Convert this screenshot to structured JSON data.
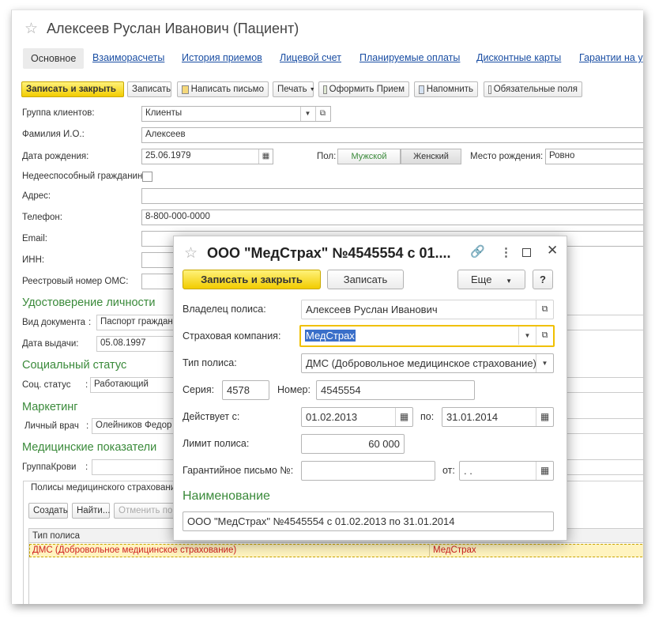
{
  "window": {
    "title": "Алексеев Руслан Иванович (Пациент)"
  },
  "tabs": [
    "Основное",
    "Взаиморасчеты",
    "История приемов",
    "Лицевой счет",
    "Планируемые оплаты",
    "Дисконтные карты",
    "Гарантии на у"
  ],
  "toolbar": {
    "save_close": "Записать и закрыть",
    "save": "Записать",
    "write_letter": "Написать письмо",
    "print": "Печать",
    "make_appointment": "Оформить Прием",
    "remind": "Напомнить",
    "required_fields": "Обязательные поля"
  },
  "form": {
    "client_group_label": "Группа клиентов:",
    "client_group_value": "Клиенты",
    "fio_label": "Фамилия И.О.:",
    "fio_value": "Алексеев",
    "birth_label": "Дата рождения:",
    "birth_value": "25.06.1979",
    "gender_label": "Пол:",
    "gender_male": "Мужской",
    "gender_female": "Женский",
    "birthplace_label": "Место рождения:",
    "birthplace_value": "Ровно",
    "incapable_label": "Недееспособный гражданин:",
    "address_label": "Адрес:",
    "phone_label": "Телефон:",
    "phone_value": "8-800-000-0000",
    "email_label": "Email:",
    "inn_label": "ИНН:",
    "oms_label": "Реестровый номер ОМС:"
  },
  "identity": {
    "header": "Удостоверение личности",
    "doc_type_label": "Вид документа",
    "doc_type_value": "Паспорт граждани",
    "issue_date_label": "Дата выдачи:",
    "issue_date_value": "05.08.1997"
  },
  "social": {
    "header": "Социальный статус",
    "status_label": "Соц. статус",
    "status_value": "Работающий"
  },
  "marketing": {
    "header": "Маркетинг",
    "doctor_label": "Личный врач",
    "doctor_value": "Олейников Федор С"
  },
  "medical": {
    "header": "Медицинские показатели",
    "blood_label": "ГруппаКрови"
  },
  "policies": {
    "group_title": "Полисы медицинского страховани",
    "create": "Создать",
    "find": "Найти...",
    "cancel_search": "Отменить пои",
    "col_type": "Тип полиса",
    "row_type": "ДМС (Добровольное медицинское страхование)",
    "row_company": "МедСтрах"
  },
  "dialog": {
    "title": "ООО \"МедСтрах\" №4545554 с 01....",
    "save_close": "Записать и закрыть",
    "save": "Записать",
    "more": "Еще",
    "help": "?",
    "owner_label": "Владелец полиса:",
    "owner_value": "Алексеев Руслан Иванович",
    "company_label": "Страховая компания:",
    "company_value": "МедСтрах",
    "type_label": "Тип полиса:",
    "type_value": "ДМС (Добровольное медицинское страхование)",
    "series_label": "Серия:",
    "series_value": "4578",
    "number_label": "Номер:",
    "number_value": "4545554",
    "valid_from_label": "Действует с:",
    "valid_from_value": "01.02.2013",
    "valid_to_label": "по:",
    "valid_to_value": "31.01.2014",
    "limit_label": "Лимит полиса:",
    "limit_value": "60 000",
    "guarantee_label": "Гарантийное письмо №:",
    "from_label": "от:",
    "from_value": " .  .",
    "name_header": "Наименование",
    "name_value": "ООО \"МедСтрах\" №4545554 с 01.02.2013 по 31.01.2014"
  },
  "colors": {
    "accent_green": "#3a8a3a",
    "link_blue": "#1a4ea3",
    "button_yellow": "#f2cc00",
    "row_highlight": "#fff4c0",
    "row_text_red": "#d02020"
  }
}
